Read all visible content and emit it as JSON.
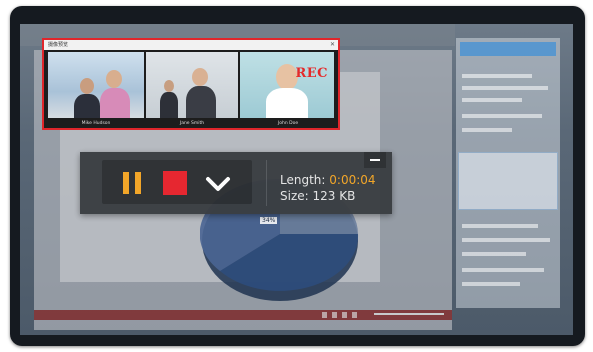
{
  "webcam": {
    "title": "摄像预览",
    "rec_label": "REC",
    "participants": [
      "Mike Hudson",
      "Jane Smith",
      "John Doe"
    ]
  },
  "recorder": {
    "length_label": "Length:",
    "length_value": "0:00:04",
    "size_label": "Size:",
    "size_value": "123 KB",
    "controls": [
      "pause-icon",
      "stop-icon",
      "chevron-down-icon",
      "minimize-icon"
    ]
  },
  "background_app": {
    "chart_label": "34%"
  },
  "colors": {
    "accent_orange": "#f5a623",
    "stop_red": "#e8222b",
    "rec_red": "#e52a2a"
  }
}
